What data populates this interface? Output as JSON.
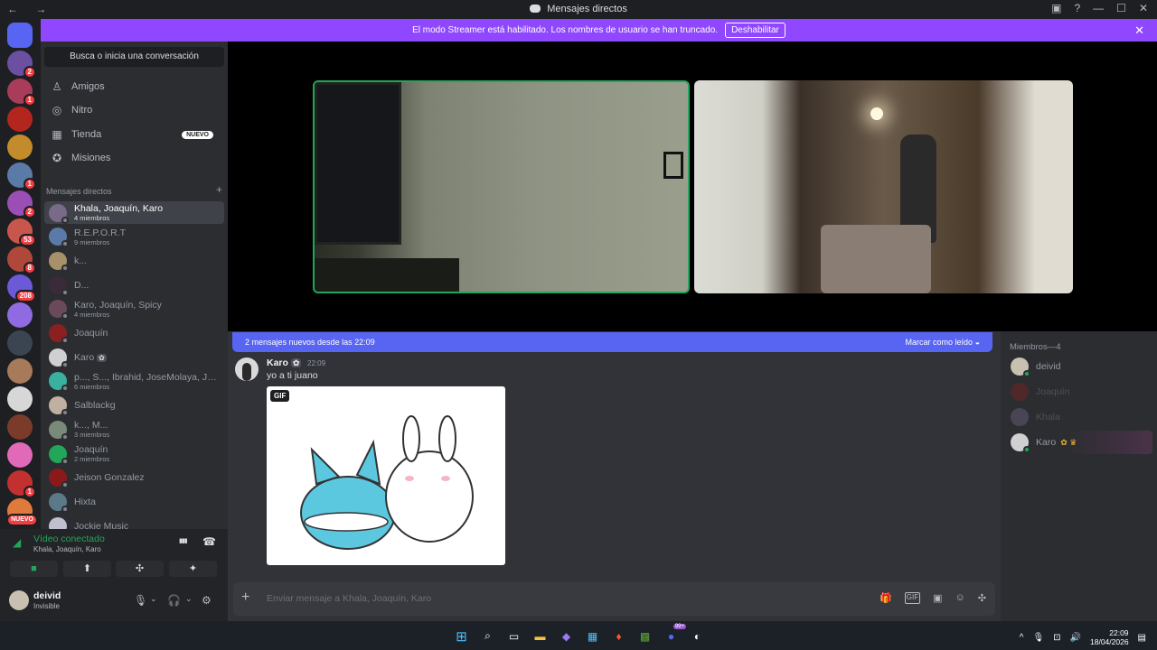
{
  "window": {
    "title": "Mensajes directos",
    "nav": "← →",
    "controls": [
      "▣",
      "?",
      "—",
      "☐",
      "✕"
    ]
  },
  "banner": {
    "text": "El modo Streamer está habilitado. Los nombres de usuario se han truncado.",
    "button": "Deshabilitar",
    "close": "✕"
  },
  "guilds": [
    {
      "color": "#5865f2",
      "badge": ""
    },
    {
      "color": "#6b4fa0",
      "badge": "2"
    },
    {
      "color": "#a83c5a",
      "badge": "1"
    },
    {
      "color": "#b3261e",
      "badge": ""
    },
    {
      "color": "#c28b2b",
      "badge": ""
    },
    {
      "color": "#5a7aa8",
      "badge": "1"
    },
    {
      "color": "#9b4fb5",
      "badge": "2"
    },
    {
      "color": "#c9564c",
      "badge": "53"
    },
    {
      "color": "#b0483a",
      "badge": "8"
    },
    {
      "color": "#6a5ad8",
      "badge": "208"
    },
    {
      "color": "#8f6ae0",
      "badge": ""
    },
    {
      "color": "#3b4552",
      "badge": ""
    },
    {
      "color": "#a87a5c",
      "badge": ""
    },
    {
      "color": "#d7d7d7",
      "badge": ""
    },
    {
      "color": "#7a3b2b",
      "badge": ""
    },
    {
      "color": "#e06ab8",
      "badge": ""
    },
    {
      "color": "#c2302f",
      "badge": "1"
    },
    {
      "color": "#e07a3b",
      "badge": "NUEVO"
    }
  ],
  "sidebar": {
    "search": "Busca o inicia una conversación",
    "nav": [
      {
        "icon": "♙",
        "label": "Amigos"
      },
      {
        "icon": "◎",
        "label": "Nitro"
      },
      {
        "icon": "▦",
        "label": "Tienda",
        "badge": "NUEVO"
      },
      {
        "icon": "✪",
        "label": "Misiones"
      }
    ],
    "dm_header": "Mensajes directos",
    "dm_add": "+",
    "dms": [
      {
        "name": "Khala, Joaquín, Karo",
        "sub": "4 miembros",
        "color": "#7a6a8a",
        "active": true
      },
      {
        "name": "R.E.P.O.R.T",
        "sub": "9 miembros",
        "color": "#5a7aa8"
      },
      {
        "name": "k...",
        "sub": "",
        "color": "#a8916a"
      },
      {
        "name": "D...",
        "sub": "",
        "color": "#3a2a3a"
      },
      {
        "name": "Karo, Joaquín, Spicy",
        "sub": "4 miembros",
        "color": "#6a4a5a"
      },
      {
        "name": "Joaquín",
        "sub": "",
        "color": "#8a2020"
      },
      {
        "name": "Karo",
        "sub": "",
        "color": "#d0d0d0",
        "tag": "✿"
      },
      {
        "name": "p..., S..., Ibrahid, JoseMolaya, Jud...",
        "sub": "6 miembros",
        "color": "#3ab0a0"
      },
      {
        "name": "Salblackg",
        "sub": "",
        "color": "#c0b0a0"
      },
      {
        "name": "k..., M...",
        "sub": "3 miembros",
        "color": "#7a8a7a"
      },
      {
        "name": "Joaquín",
        "sub": "2 miembros",
        "color": "#23a55a"
      },
      {
        "name": "Jeison Gonzalez",
        "sub": "",
        "color": "#8a1a1a"
      },
      {
        "name": "Hixta",
        "sub": "",
        "color": "#5a7a8a"
      },
      {
        "name": "Jockie Music",
        "sub": "",
        "color": "#c0c0d0"
      }
    ]
  },
  "voice": {
    "status": "Vídeo conectado",
    "channel": "Khala, Joaquín, Karo",
    "icons": [
      "▮▮▮",
      "☎"
    ],
    "buttons": [
      "■",
      "⬆",
      "✣",
      "✦"
    ]
  },
  "user": {
    "name": "deivid",
    "status": "Invisible",
    "icons": [
      "🎙",
      "⌄",
      "🎧",
      "⌄",
      "⚙"
    ]
  },
  "chat": {
    "new_messages": "2 mensajes nuevos desde las 22:09",
    "mark_read": "Marcar como leído",
    "message": {
      "author": "Karo",
      "badge": "✿",
      "time": "22:09",
      "text": "yo a ti juano",
      "gif_label": "GIF"
    },
    "composer_placeholder": "Enviar mensaje a Khala, Joaquín, Karo",
    "composer_plus": "+",
    "composer_icons": [
      "🎁",
      "GIF",
      "▣",
      "☺",
      "✣"
    ]
  },
  "members": {
    "header": "Miembros—4",
    "list": [
      {
        "name": "deivid",
        "color": "#c8c0b0",
        "online": true
      },
      {
        "name": "Joaquín",
        "color": "#8a2020",
        "online": false
      },
      {
        "name": "Khala",
        "color": "#7a6a8a",
        "online": false
      },
      {
        "name": "Karo",
        "color": "#d0d0d0",
        "online": true,
        "tags": "✿ ♛"
      }
    ]
  },
  "taskbar": {
    "apps": [
      "⊞",
      "⌕",
      "▭",
      "▬",
      "◆",
      "▦",
      "♦",
      "▩",
      "●",
      "◐"
    ],
    "tray": [
      "^",
      "🎙",
      "⊡",
      "🔊"
    ],
    "time": "22:09",
    "date": "18/04/2026",
    "notif": "99+"
  }
}
